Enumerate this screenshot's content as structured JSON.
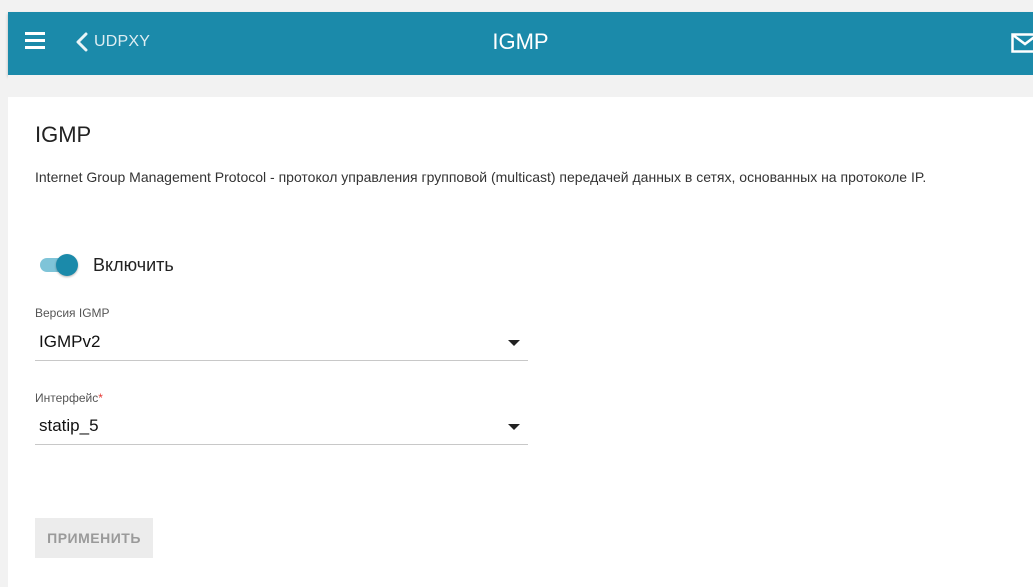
{
  "header": {
    "back_label": "UDPXY",
    "title": "IGMP",
    "bar_color": "#1b8aaa",
    "icons": [
      "menu-icon",
      "chevron-left-icon",
      "mail-icon"
    ]
  },
  "main": {
    "section_title": "IGMP",
    "description": "Internet Group Management Protocol - протокол управления групповой (multicast) передачей данных в сетях, основанных на протоколе IP.",
    "enable": {
      "label": "Включить",
      "on": true
    },
    "igmp_version": {
      "label": "Версия IGMP",
      "value": "IGMPv2"
    },
    "interface": {
      "label": "Интерфейс",
      "required_mark": "*",
      "value": "statip_5"
    },
    "apply_label": "ПРИМЕНИТЬ"
  }
}
